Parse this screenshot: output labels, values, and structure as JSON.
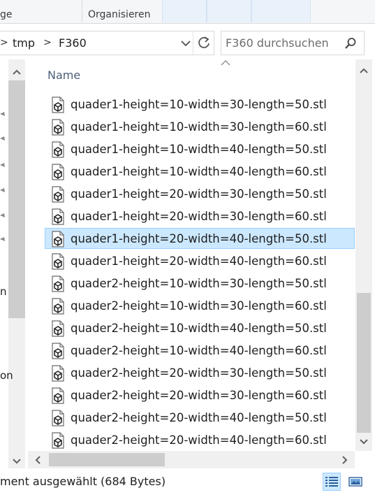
{
  "ribbon": {
    "fragment_label": "ge",
    "organize_label": "Organisieren"
  },
  "address": {
    "path": [
      "tmp",
      "F360"
    ],
    "separator": ">"
  },
  "search": {
    "placeholder": "F360 durchsuchen"
  },
  "navpane": {
    "fragment_a": "n",
    "fragment_b": "on"
  },
  "list": {
    "column_name": "Name",
    "sort": "ascending",
    "selected_index": 6,
    "files": [
      "quader1-height=10-width=30-length=50.stl",
      "quader1-height=10-width=30-length=60.stl",
      "quader1-height=10-width=40-length=50.stl",
      "quader1-height=10-width=40-length=60.stl",
      "quader1-height=20-width=30-length=50.stl",
      "quader1-height=20-width=30-length=60.stl",
      "quader1-height=20-width=40-length=50.stl",
      "quader1-height=20-width=40-length=60.stl",
      "quader2-height=10-width=30-length=50.stl",
      "quader2-height=10-width=30-length=60.stl",
      "quader2-height=10-width=40-length=50.stl",
      "quader2-height=10-width=40-length=60.stl",
      "quader2-height=20-width=30-length=50.stl",
      "quader2-height=20-width=30-length=60.stl",
      "quader2-height=20-width=40-length=50.stl",
      "quader2-height=20-width=40-length=60.stl"
    ]
  },
  "status": {
    "text": "ment ausgewählt (684 Bytes)",
    "active_view": "details"
  },
  "icons": {
    "file": "3d-model-file-icon",
    "refresh": "refresh-icon",
    "search": "search-icon",
    "dropdown": "chevron-down-icon"
  },
  "colors": {
    "selection_fill": "#cce8ff",
    "selection_border": "#99d1ff",
    "header_text": "#4c607a"
  }
}
